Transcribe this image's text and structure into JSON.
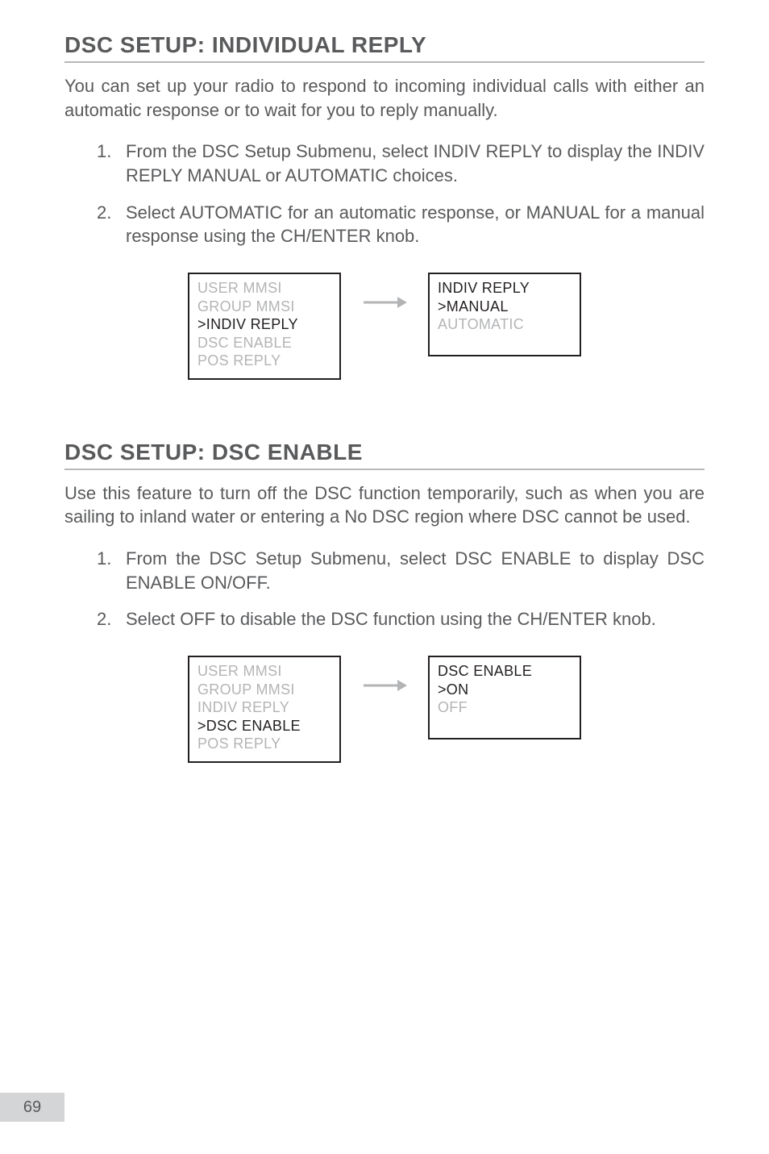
{
  "page_number": "69",
  "sections": [
    {
      "title": "DSC SETUP: INDIVIDUAL REPLY",
      "intro": "You can set up your radio to respond to incoming individual calls with either an automatic response or to wait for you to reply manually.",
      "steps": [
        {
          "num": "1.",
          "text": "From the DSC Setup Submenu, select INDIV REPLY to display the INDIV REPLY MANUAL or AUTOMATIC choices."
        },
        {
          "num": "2.",
          "text": "Select AUTOMATIC for an automatic response, or MANUAL for a manual response using the CH/ENTER knob."
        }
      ],
      "lcd_left": {
        "lines": [
          {
            "text": "USER MMSI",
            "dim": true
          },
          {
            "text": "GROUP MMSI",
            "dim": true
          },
          {
            "text": ">INDIV REPLY",
            "dim": false
          },
          {
            "text": "DSC ENABLE",
            "dim": true
          },
          {
            "text": "POS REPLY",
            "dim": true
          }
        ]
      },
      "lcd_right": {
        "lines": [
          {
            "text": "INDIV REPLY",
            "dim": false
          },
          {
            "text": ">MANUAL",
            "dim": false
          },
          {
            "text": " AUTOMATIC",
            "dim": true
          }
        ]
      }
    },
    {
      "title": "DSC SETUP: DSC ENABLE",
      "intro": "Use this feature to turn off the DSC function temporarily, such as when you are sailing to inland water or entering a No DSC region where DSC cannot be used.",
      "steps": [
        {
          "num": "1.",
          "text": "From the DSC Setup Submenu, select DSC ENABLE to display DSC ENABLE ON/OFF."
        },
        {
          "num": "2.",
          "text": "Select OFF to disable the DSC function using the CH/ENTER knob."
        }
      ],
      "lcd_left": {
        "lines": [
          {
            "text": "USER MMSI",
            "dim": true
          },
          {
            "text": "GROUP MMSI",
            "dim": true
          },
          {
            "text": "INDIV REPLY",
            "dim": true
          },
          {
            "text": ">DSC ENABLE",
            "dim": false
          },
          {
            "text": "POS REPLY",
            "dim": true
          }
        ]
      },
      "lcd_right": {
        "lines": [
          {
            "text": "DSC ENABLE",
            "dim": false
          },
          {
            "text": ">ON",
            "dim": false
          },
          {
            "text": " OFF",
            "dim": true
          }
        ]
      }
    }
  ]
}
